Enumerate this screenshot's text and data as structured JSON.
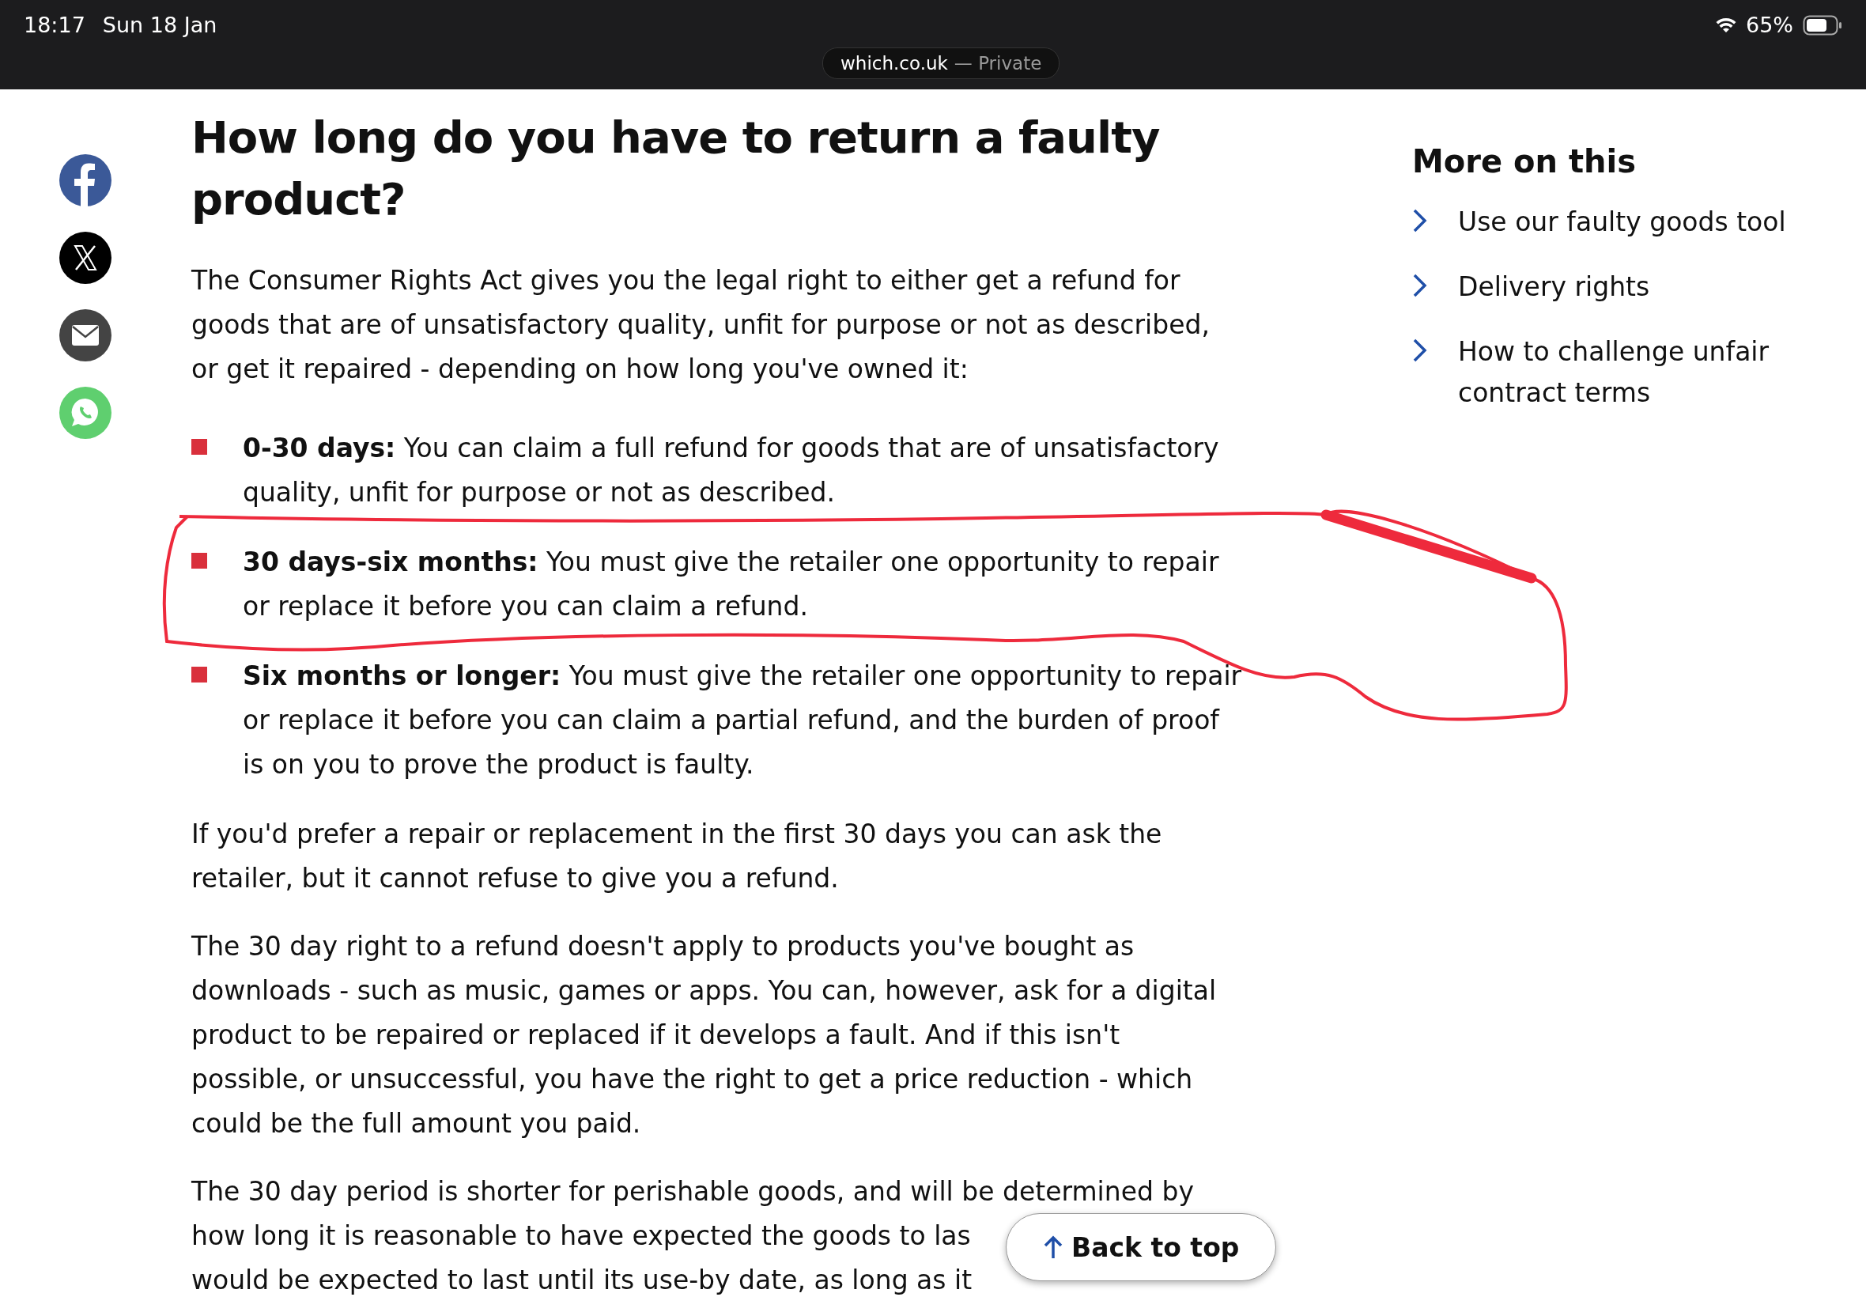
{
  "status_bar": {
    "time": "18:17",
    "date": "Sun 18 Jan",
    "url": "which.co.uk",
    "mode": "— Private",
    "battery": "65%"
  },
  "share_icons": [
    {
      "kind": "facebook"
    },
    {
      "kind": "x"
    },
    {
      "kind": "email"
    },
    {
      "kind": "whatsapp"
    }
  ],
  "article": {
    "title": "How long do you have to return a faulty product?",
    "intro": "The Consumer Rights Act gives you the legal right to either get a refund for goods that are of unsatisfactory quality, unfit for purpose or not as described, or get it repaired  - depending on how long you've owned it:",
    "bullets": [
      {
        "text": "**0-30 days:** You can claim a full refund for goods that are of unsatisfactory quality, unfit for purpose or not as described.",
        "highlighted": false
      },
      {
        "text": "**30 days-six months:** You must give the retailer one opportunity to repair or replace it before you can claim a refund.",
        "highlighted": true
      },
      {
        "text": "**Six months or longer:** You must give the retailer one opportunity to repair or replace it before you can claim a partial refund, and the burden of proof is on you to prove the product is faulty.",
        "highlighted": false
      }
    ],
    "paragraphs": [
      "If you'd prefer a repair or replacement in the first 30 days you can ask the retailer, but it cannot refuse to give you a refund.",
      "The 30 day right to a refund doesn't apply to products you've bought as downloads - such as music, games or apps. You can, however, ask for a digital product to be repaired or replaced if it develops a fault. And if this isn't possible, or unsuccessful, you have the right to get a price reduction - which could be the full amount you paid."
    ],
    "last_paragraph_lines": [
      "The 30 day period is shorter for perishable goods, and will be determined by",
      "how long it is reasonable to have expected the goods to las",
      "would be expected to last until its use-by date, as long as it"
    ]
  },
  "sidebar": {
    "title": "More on this",
    "links": [
      "Use our faulty goods tool",
      "Delivery rights",
      "How to challenge unfair contract terms"
    ]
  },
  "back_to_top": "Back to top"
}
